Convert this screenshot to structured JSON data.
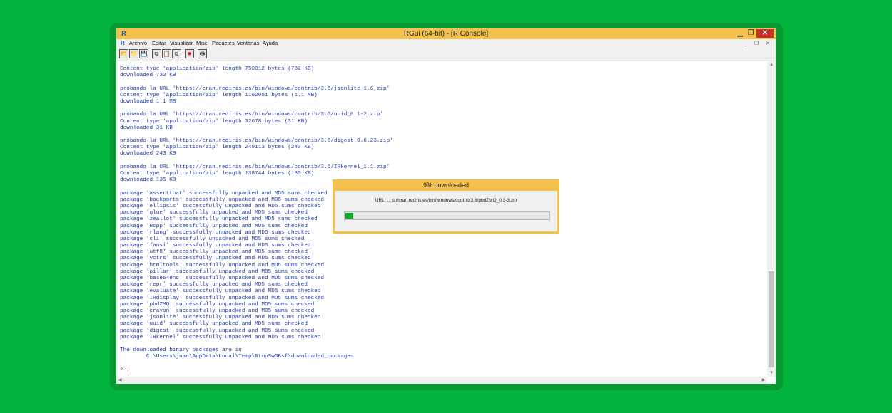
{
  "window": {
    "title": "RGui (64-bit) - [R Console]",
    "app_icon": "R",
    "controls": {
      "minimize": "▁",
      "maximize": "❐",
      "close": "✕"
    }
  },
  "menubar": {
    "icon": "R",
    "items": [
      "Archivo",
      "Editar",
      "Visualizar",
      "Misc",
      "Paquetes",
      "Ventanas",
      "Ayuda"
    ],
    "mdi_controls": "_ ❐ ✕"
  },
  "toolbar": {
    "buttons": [
      {
        "icon": "open-script-icon",
        "glyph": "📂"
      },
      {
        "icon": "load-workspace-icon",
        "glyph": "📁"
      },
      {
        "icon": "save-icon",
        "glyph": "💾"
      },
      {
        "icon": "copy-icon",
        "glyph": "⧉"
      },
      {
        "icon": "paste-icon",
        "glyph": "📋"
      },
      {
        "icon": "copy-paste-icon",
        "glyph": "⧉"
      },
      {
        "icon": "stop-icon",
        "glyph": "●"
      },
      {
        "icon": "print-icon",
        "glyph": "🖶"
      }
    ]
  },
  "console": {
    "lines": [
      "Content type 'application/zip' length 750012 bytes (732 KB)",
      "downloaded 732 KB",
      "",
      "probando la URL 'https://cran.rediris.es/bin/windows/contrib/3.6/jsonlite_1.6.zip'",
      "Content type 'application/zip' length 1162051 bytes (1.1 MB)",
      "downloaded 1.1 MB",
      "",
      "probando la URL 'https://cran.rediris.es/bin/windows/contrib/3.6/uuid_0.1-2.zip'",
      "Content type 'application/zip' length 32678 bytes (31 KB)",
      "downloaded 31 KB",
      "",
      "probando la URL 'https://cran.rediris.es/bin/windows/contrib/3.6/digest_0.6.23.zip'",
      "Content type 'application/zip' length 249113 bytes (243 KB)",
      "downloaded 243 KB",
      "",
      "probando la URL 'https://cran.rediris.es/bin/windows/contrib/3.6/IRkernel_1.1.zip'",
      "Content type 'application/zip' length 138744 bytes (135 KB)",
      "downloaded 135 KB",
      "",
      "package 'assertthat' successfully unpacked and MD5 sums checked",
      "package 'backports' successfully unpacked and MD5 sums checked",
      "package 'ellipsis' successfully unpacked and MD5 sums checked",
      "package 'glue' successfully unpacked and MD5 sums checked",
      "package 'zeallot' successfully unpacked and MD5 sums checked",
      "package 'Rcpp' successfully unpacked and MD5 sums checked",
      "package 'rlang' successfully unpacked and MD5 sums checked",
      "package 'cli' successfully unpacked and MD5 sums checked",
      "package 'fansi' successfully unpacked and MD5 sums checked",
      "package 'utf8' successfully unpacked and MD5 sums checked",
      "package 'vctrs' successfully unpacked and MD5 sums checked",
      "package 'htmltools' successfully unpacked and MD5 sums checked",
      "package 'pillar' successfully unpacked and MD5 sums checked",
      "package 'base64enc' successfully unpacked and MD5 sums checked",
      "package 'repr' successfully unpacked and MD5 sums checked",
      "package 'evaluate' successfully unpacked and MD5 sums checked",
      "package 'IRdisplay' successfully unpacked and MD5 sums checked",
      "package 'pbdZMQ' successfully unpacked and MD5 sums checked",
      "package 'crayon' successfully unpacked and MD5 sums checked",
      "package 'jsonlite' successfully unpacked and MD5 sums checked",
      "package 'uuid' successfully unpacked and MD5 sums checked",
      "package 'digest' successfully unpacked and MD5 sums checked",
      "package 'IRkernel' successfully unpacked and MD5 sums checked",
      "",
      "The downloaded binary packages are in",
      "        C:\\Users\\juan\\AppData\\Local\\Temp\\RtmpSwGBsf\\downloaded_packages"
    ],
    "prompt": "> |"
  },
  "download_dialog": {
    "title": "9% downloaded",
    "url_text": "URL: ... s://cran.rediris.es/bin/windows/contrib/3.6/pbdZMQ_0.3-3.zip",
    "progress_fraction": 0.04
  }
}
